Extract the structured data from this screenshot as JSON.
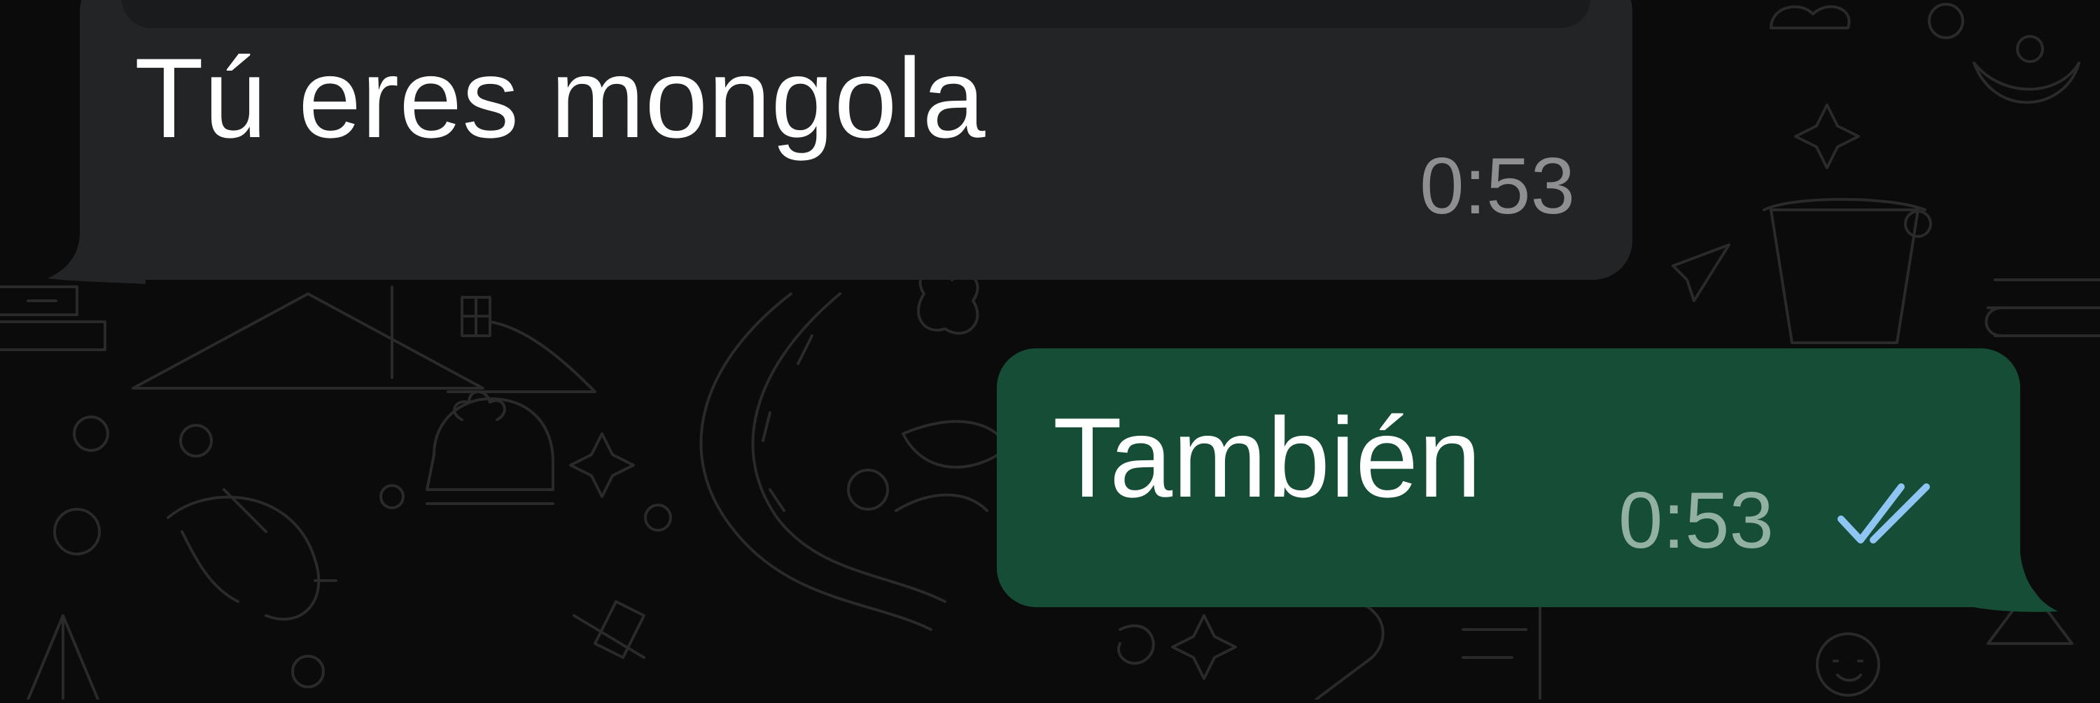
{
  "chat": {
    "messages": [
      {
        "direction": "incoming",
        "text": "Tú eres mongola",
        "time": "0:53",
        "has_quoted_reply": true
      },
      {
        "direction": "outgoing",
        "text": "También",
        "time": "0:53",
        "status": "read"
      }
    ]
  },
  "colors": {
    "background": "#0b0b0b",
    "incoming_bubble": "#232426",
    "outgoing_bubble": "#154d36",
    "read_ticks": "#8ec5f3",
    "quote_accent": "#e8a783"
  },
  "icons": {
    "read_receipt": "double-check-icon"
  }
}
